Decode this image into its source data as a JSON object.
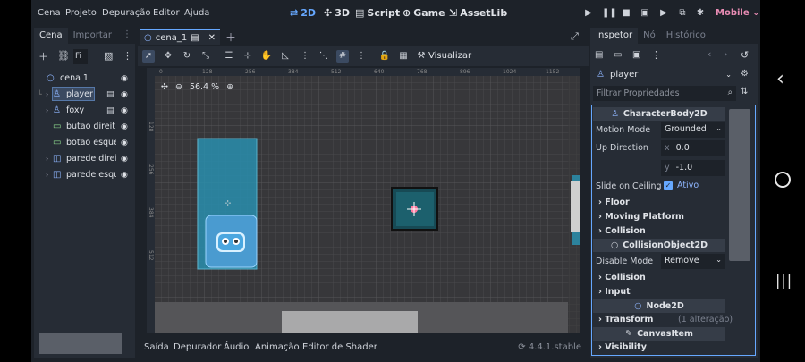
{
  "menu": {
    "items": [
      "Cena",
      "Projeto",
      "Depuração",
      "Editor",
      "Ajuda"
    ]
  },
  "workspaces": [
    {
      "icon": "2d-icon",
      "label": "2D",
      "active": true
    },
    {
      "icon": "3d-icon",
      "label": "3D",
      "active": false
    },
    {
      "icon": "script-icon",
      "label": "Script",
      "active": false
    },
    {
      "icon": "game-icon",
      "label": "Game",
      "active": false
    },
    {
      "icon": "assetlib-icon",
      "label": "AssetLib",
      "active": false
    }
  ],
  "renderer": "Mobile",
  "scene_dock": {
    "tabs": [
      "Cena",
      "Importar"
    ],
    "filter_placeholder": "Fi",
    "tree": [
      {
        "label": "cena 1",
        "icon": "node-icon"
      },
      {
        "label": "player",
        "icon": "characterbody-icon",
        "selected": true
      },
      {
        "label": "foxy",
        "icon": "characterbody-icon"
      },
      {
        "label": "butao direit",
        "icon": "button-icon"
      },
      {
        "label": "botao esque",
        "icon": "button-icon"
      },
      {
        "label": "parede direi",
        "icon": "staticbody-icon"
      },
      {
        "label": "parede esqu",
        "icon": "staticbody-icon"
      }
    ]
  },
  "editor": {
    "scene_tab": "cena_1",
    "visualizar": "Visualizar",
    "zoom": "56.4 %",
    "ruler_ticks": [
      "0",
      "128",
      "256",
      "384",
      "512",
      "640",
      "768",
      "896",
      "1024",
      "1152"
    ],
    "ruler_left_ticks": [
      "128",
      "256",
      "384",
      "512"
    ]
  },
  "bottom_panel": {
    "tabs": [
      "Saída",
      "Depurador",
      "Áudio",
      "Animação",
      "Editor de Shader"
    ],
    "version": "4.4.1.stable"
  },
  "inspector": {
    "tabs": [
      "Inspetor",
      "Nó",
      "Histórico"
    ],
    "node_name": "player",
    "filter_placeholder": "Filtrar Propriedades",
    "class_header": "CharacterBody2D",
    "motion_mode_label": "Motion Mode",
    "motion_mode_value": "Grounded",
    "up_direction_label": "Up Direction",
    "up_x_label": "x",
    "up_x": "0.0",
    "up_y_label": "y",
    "up_y": "-1.0",
    "slide_label": "Slide on Ceiling",
    "slide_value": "Ativo",
    "floor": "Floor",
    "moving_platform": "Moving Platform",
    "collision": "Collision",
    "collision_object_header": "CollisionObject2D",
    "disable_mode_label": "Disable Mode",
    "disable_mode_value": "Remove",
    "collision2": "Collision",
    "input": "Input",
    "node2d_header": "Node2D",
    "transform": "Transform",
    "transform_note": "(1 alteração)",
    "canvasitem_header": "CanvasItem",
    "visibility": "Visibility"
  },
  "colors": {
    "accent": "#66a8ff",
    "renderer": "#e88cb4",
    "panel": "#262c35",
    "background": "#1d2229"
  }
}
